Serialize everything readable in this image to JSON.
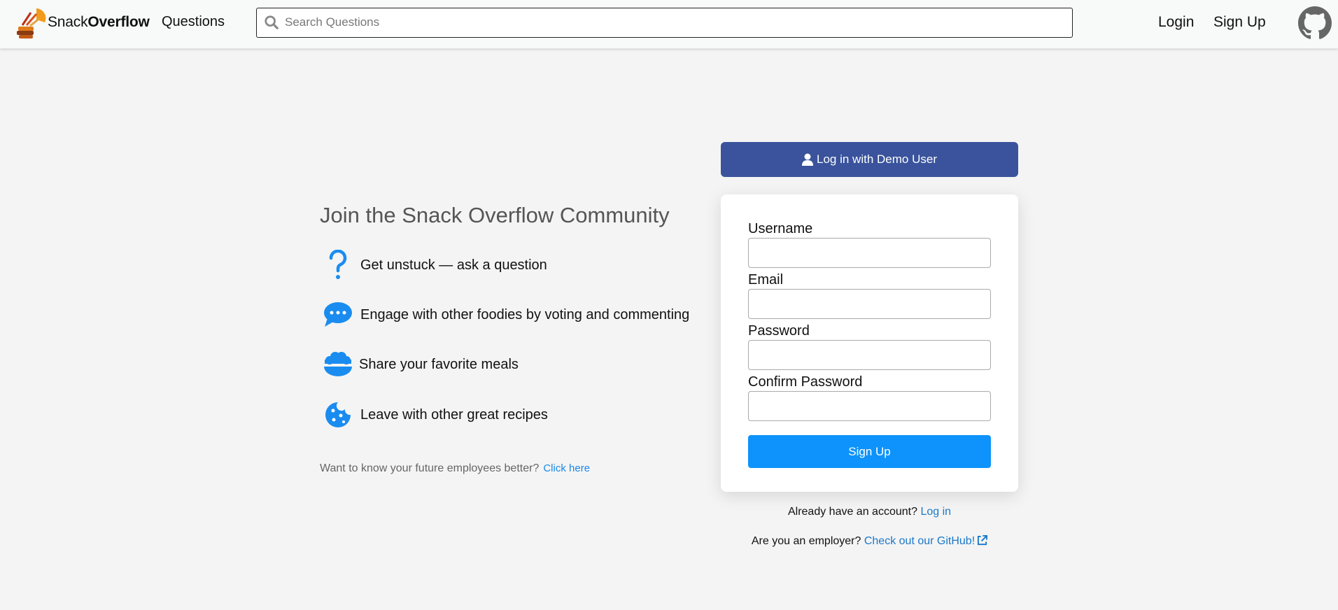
{
  "header": {
    "brand_light": "Snack",
    "brand_bold": "Overflow",
    "questions_link": "Questions",
    "search_placeholder": "Search Questions",
    "login_link": "Login",
    "signup_link": "Sign Up"
  },
  "intro": {
    "title": "Join the Snack Overflow Community",
    "features": [
      {
        "icon": "question-mark-icon",
        "text": "Get unstuck — ask a question"
      },
      {
        "icon": "chat-bubble-icon",
        "text": "Engage with other foodies by voting and commenting"
      },
      {
        "icon": "bowl-icon",
        "text": "Share your favorite meals"
      },
      {
        "icon": "cookie-icon",
        "text": "Leave with other great recipes"
      }
    ],
    "employer_note": "Want to know your future employees better?",
    "employer_link": "Click here"
  },
  "demo_button": {
    "label": "Log in with Demo User",
    "icon": "user-icon"
  },
  "form": {
    "username_label": "Username",
    "email_label": "Email",
    "password_label": "Password",
    "confirm_label": "Confirm Password",
    "submit_label": "Sign Up"
  },
  "footer_links": {
    "account_text": "Already have an account?",
    "account_link": "Log in",
    "employer_text": "Are you an employer?",
    "github_link": "Check out our GitHub!"
  },
  "colors": {
    "demo_button": "#3a539c",
    "primary_button": "#0d93fb",
    "link": "#1a78c9",
    "icon_blue": "#1a8cf0"
  }
}
